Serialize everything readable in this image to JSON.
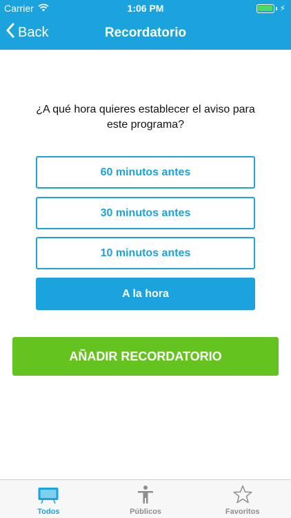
{
  "status_bar": {
    "carrier": "Carrier",
    "time": "1:06 PM"
  },
  "nav": {
    "back_label": "Back",
    "title": "Recordatorio"
  },
  "question": "¿A qué hora quieres establecer el aviso para este programa?",
  "options": [
    {
      "label": "60 minutos antes",
      "selected": false
    },
    {
      "label": "30 minutos antes",
      "selected": false
    },
    {
      "label": "10 minutos antes",
      "selected": false
    },
    {
      "label": "A la hora",
      "selected": true
    }
  ],
  "add_button": "AÑADIR RECORDATORIO",
  "tabs": [
    {
      "label": "Todos",
      "icon": "tv-icon",
      "active": true
    },
    {
      "label": "Públicos",
      "icon": "person-icon",
      "active": false
    },
    {
      "label": "Favoritos",
      "icon": "star-icon",
      "active": false
    }
  ],
  "colors": {
    "accent": "#1aa3dc",
    "add_button": "#64c31e",
    "battery": "#4cd964"
  }
}
